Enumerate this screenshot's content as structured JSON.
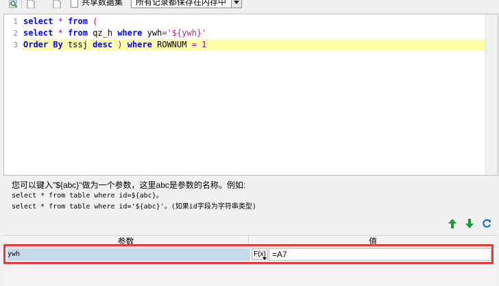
{
  "toolbar": {
    "share_dataset_label": "共享数据集",
    "storage_select_value": "所有记录都保存在内存中"
  },
  "editor": {
    "line_numbers": [
      "1",
      "2",
      "3"
    ],
    "lines": [
      {
        "tokens": [
          {
            "t": "select",
            "c": "kw"
          },
          {
            "t": " ",
            "c": ""
          },
          {
            "t": "*",
            "c": "op"
          },
          {
            "t": " ",
            "c": ""
          },
          {
            "t": "from",
            "c": "kw"
          },
          {
            "t": " ",
            "c": ""
          },
          {
            "t": "(",
            "c": "op"
          }
        ]
      },
      {
        "tokens": [
          {
            "t": "select",
            "c": "kw"
          },
          {
            "t": " ",
            "c": ""
          },
          {
            "t": "*",
            "c": "op"
          },
          {
            "t": " ",
            "c": ""
          },
          {
            "t": "from",
            "c": "kw"
          },
          {
            "t": " qz_h ",
            "c": ""
          },
          {
            "t": "where",
            "c": "kw"
          },
          {
            "t": " ywh",
            "c": ""
          },
          {
            "t": "=",
            "c": "op"
          },
          {
            "t": "'${ywh}'",
            "c": "str"
          }
        ]
      },
      {
        "tokens": [
          {
            "t": "Order",
            "c": "kw"
          },
          {
            "t": " ",
            "c": ""
          },
          {
            "t": "By",
            "c": "kw"
          },
          {
            "t": " tssj ",
            "c": ""
          },
          {
            "t": "desc",
            "c": "kw"
          },
          {
            "t": " ",
            "c": ""
          },
          {
            "t": ")",
            "c": "op"
          },
          {
            "t": " ",
            "c": ""
          },
          {
            "t": "where",
            "c": "kw"
          },
          {
            "t": " ROWNUM ",
            "c": ""
          },
          {
            "t": "=",
            "c": "op"
          },
          {
            "t": " ",
            "c": ""
          },
          {
            "t": "1",
            "c": "op"
          }
        ]
      }
    ]
  },
  "hint": {
    "line1": "您可以键入\"${abc}\"做为一个参数，这里abc是参数的名称。例如:",
    "line2": "select * from table where id=${abc}。",
    "line3": "select * from table where id='${abc}'。(如果id字段为字符串类型)"
  },
  "params": {
    "header_name": "参数",
    "header_value": "值",
    "rows": [
      {
        "name": "ywh",
        "fx_label": "F(x)",
        "value": "=A7"
      }
    ]
  },
  "colors": {
    "keyword": "#0000ff",
    "string": "#c0208a",
    "current_line": "#ffffaa",
    "highlight_frame": "#e23b3b",
    "arrow_green": "#1a9a3a",
    "refresh_blue": "#1e6fc8"
  },
  "icons": {
    "toolbar": [
      "preview-icon",
      "new-doc-icon",
      "doc-icon"
    ],
    "actions": [
      "move-up-icon",
      "move-down-icon",
      "refresh-icon"
    ]
  }
}
